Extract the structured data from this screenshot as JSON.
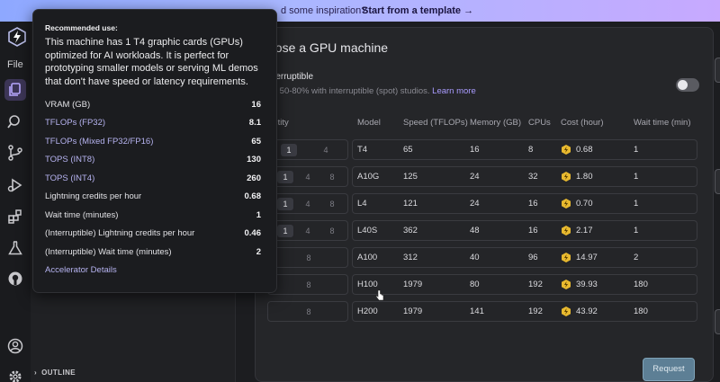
{
  "banner": {
    "text": "d some inspiration?",
    "cta": "Start from a template →"
  },
  "menu": {
    "file": "File"
  },
  "sidebar": {
    "outline": "OUTLINE"
  },
  "dialog": {
    "title": "oose a GPU machine",
    "interruptible_label": "nterruptible",
    "interruptible_sub": "ve 50-80% with interruptible (spot) studios.",
    "learn_more": "Learn more",
    "headers": [
      "antity",
      "Model",
      "Speed (TFLOPs)",
      "Memory (GB)",
      "CPUs",
      "Cost (hour)",
      "Wait time (min)"
    ],
    "rows": [
      {
        "qty": [
          "1",
          "4"
        ],
        "selected": 0,
        "model": "T4",
        "speed": "65",
        "memory": "16",
        "cpus": "8",
        "cost": "0.68",
        "wait": "1"
      },
      {
        "qty": [
          "1",
          "4",
          "8"
        ],
        "selected": 0,
        "model": "A10G",
        "speed": "125",
        "memory": "24",
        "cpus": "32",
        "cost": "1.80",
        "wait": "1"
      },
      {
        "qty": [
          "1",
          "4",
          "8"
        ],
        "selected": 0,
        "model": "L4",
        "speed": "121",
        "memory": "24",
        "cpus": "16",
        "cost": "0.70",
        "wait": "1"
      },
      {
        "qty": [
          "1",
          "4",
          "8"
        ],
        "selected": 0,
        "model": "L40S",
        "speed": "362",
        "memory": "48",
        "cpus": "16",
        "cost": "2.17",
        "wait": "1"
      },
      {
        "qty": [
          "8"
        ],
        "selected": -1,
        "model": "A100",
        "speed": "312",
        "memory": "40",
        "cpus": "96",
        "cost": "14.97",
        "wait": "2"
      },
      {
        "qty": [
          "8"
        ],
        "selected": -1,
        "model": "H100",
        "speed": "1979",
        "memory": "80",
        "cpus": "192",
        "cost": "39.93",
        "wait": "180"
      },
      {
        "qty": [
          "8"
        ],
        "selected": -1,
        "model": "H200",
        "speed": "1979",
        "memory": "141",
        "cpus": "192",
        "cost": "43.92",
        "wait": "180"
      }
    ],
    "request": "Request"
  },
  "tooltip": {
    "heading": "Recommended use:",
    "description": "This machine has 1 T4 graphic cards (GPUs) optimized for AI workloads. It is perfect for prototyping smaller models or serving ML demos that don't have speed or latency requirements.",
    "specs": [
      {
        "label": "VRAM (GB)",
        "value": "16",
        "link": false
      },
      {
        "label": "TFLOPs (FP32)",
        "value": "8.1",
        "link": true
      },
      {
        "label": "TFLOPs (Mixed FP32/FP16)",
        "value": "65",
        "link": true
      },
      {
        "label": "TOPS (INT8)",
        "value": "130",
        "link": true
      },
      {
        "label": "TOPS (INT4)",
        "value": "260",
        "link": true
      },
      {
        "label": "Lightning credits per hour",
        "value": "0.68",
        "link": false
      },
      {
        "label": "Wait time (minutes)",
        "value": "1",
        "link": false
      },
      {
        "label": "(Interruptible) Lightning credits per hour",
        "value": "0.46",
        "link": false
      },
      {
        "label": "(Interruptible) Wait time (minutes)",
        "value": "2",
        "link": false
      }
    ],
    "details_link": "Accelerator Details"
  },
  "icons": [
    "lightning-logo-icon",
    "files-icon",
    "search-icon",
    "source-control-icon",
    "run-debug-icon",
    "extensions-icon",
    "flask-icon",
    "github-icon",
    "account-icon",
    "settings-icon"
  ],
  "colors": {
    "accent": "#a99bff",
    "coin": "#e8b92f",
    "banner_start": "#8ea8ff",
    "banner_end": "#c7a9ff",
    "request_button": "#5d7f95"
  }
}
